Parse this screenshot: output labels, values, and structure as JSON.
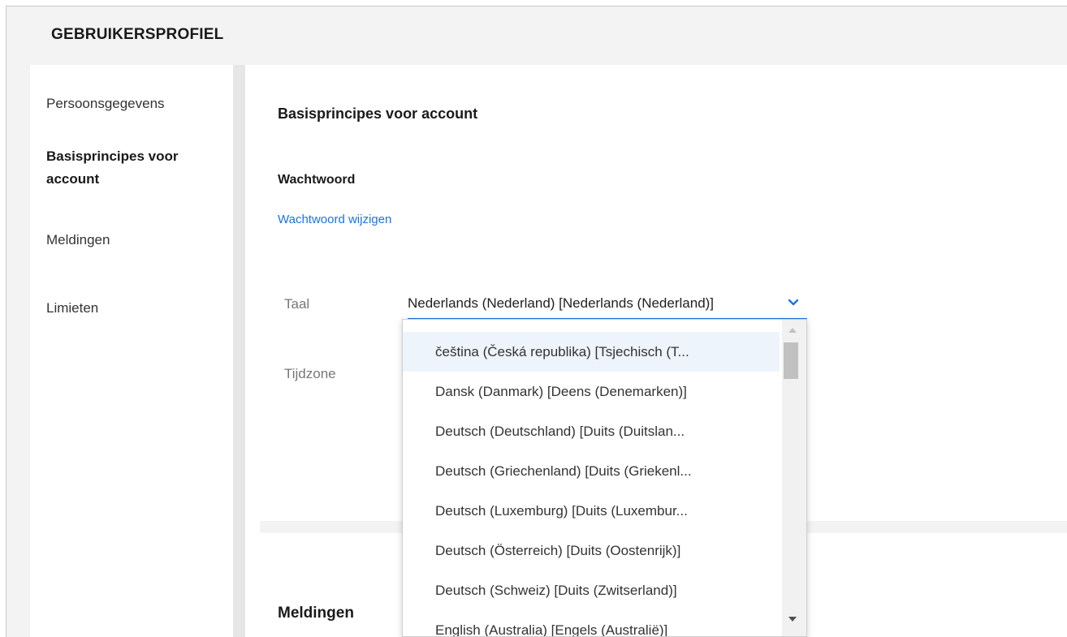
{
  "header": {
    "title": "GEBRUIKERSPROFIEL"
  },
  "sidebar": {
    "items": [
      {
        "label": "Persoonsgegevens"
      },
      {
        "label": "Basisprincipes voor account"
      },
      {
        "label": "Meldingen"
      },
      {
        "label": "Limieten"
      }
    ]
  },
  "main": {
    "section_title": "Basisprincipes voor account",
    "password": {
      "title": "Wachtwoord",
      "change_link": "Wachtwoord wijzigen"
    },
    "language": {
      "label": "Taal",
      "selected": "Nederlands (Nederland)   [Nederlands (Nederland)]"
    },
    "timezone": {
      "label": "Tijdzone"
    },
    "notifications_title": "Meldingen"
  },
  "dropdown": {
    "options": [
      "čeština (Česká republika) [Tsjechisch (T...",
      "Dansk (Danmark) [Deens (Denemarken)]",
      "Deutsch (Deutschland) [Duits (Duitslan...",
      "Deutsch (Griechenland) [Duits (Griekenl...",
      "Deutsch (Luxemburg) [Duits (Luxembur...",
      "Deutsch (Österreich) [Duits (Oostenrijk)]",
      "Deutsch (Schweiz) [Duits (Zwitserland)]",
      "English (Australia) [Engels (Australië)]"
    ],
    "highlighted_index": 0
  },
  "colors": {
    "accent": "#1a73e8",
    "background": "#f3f3f3",
    "highlight": "#eef4fb"
  },
  "icons": {
    "select_chevron": "chevron-down-icon"
  }
}
